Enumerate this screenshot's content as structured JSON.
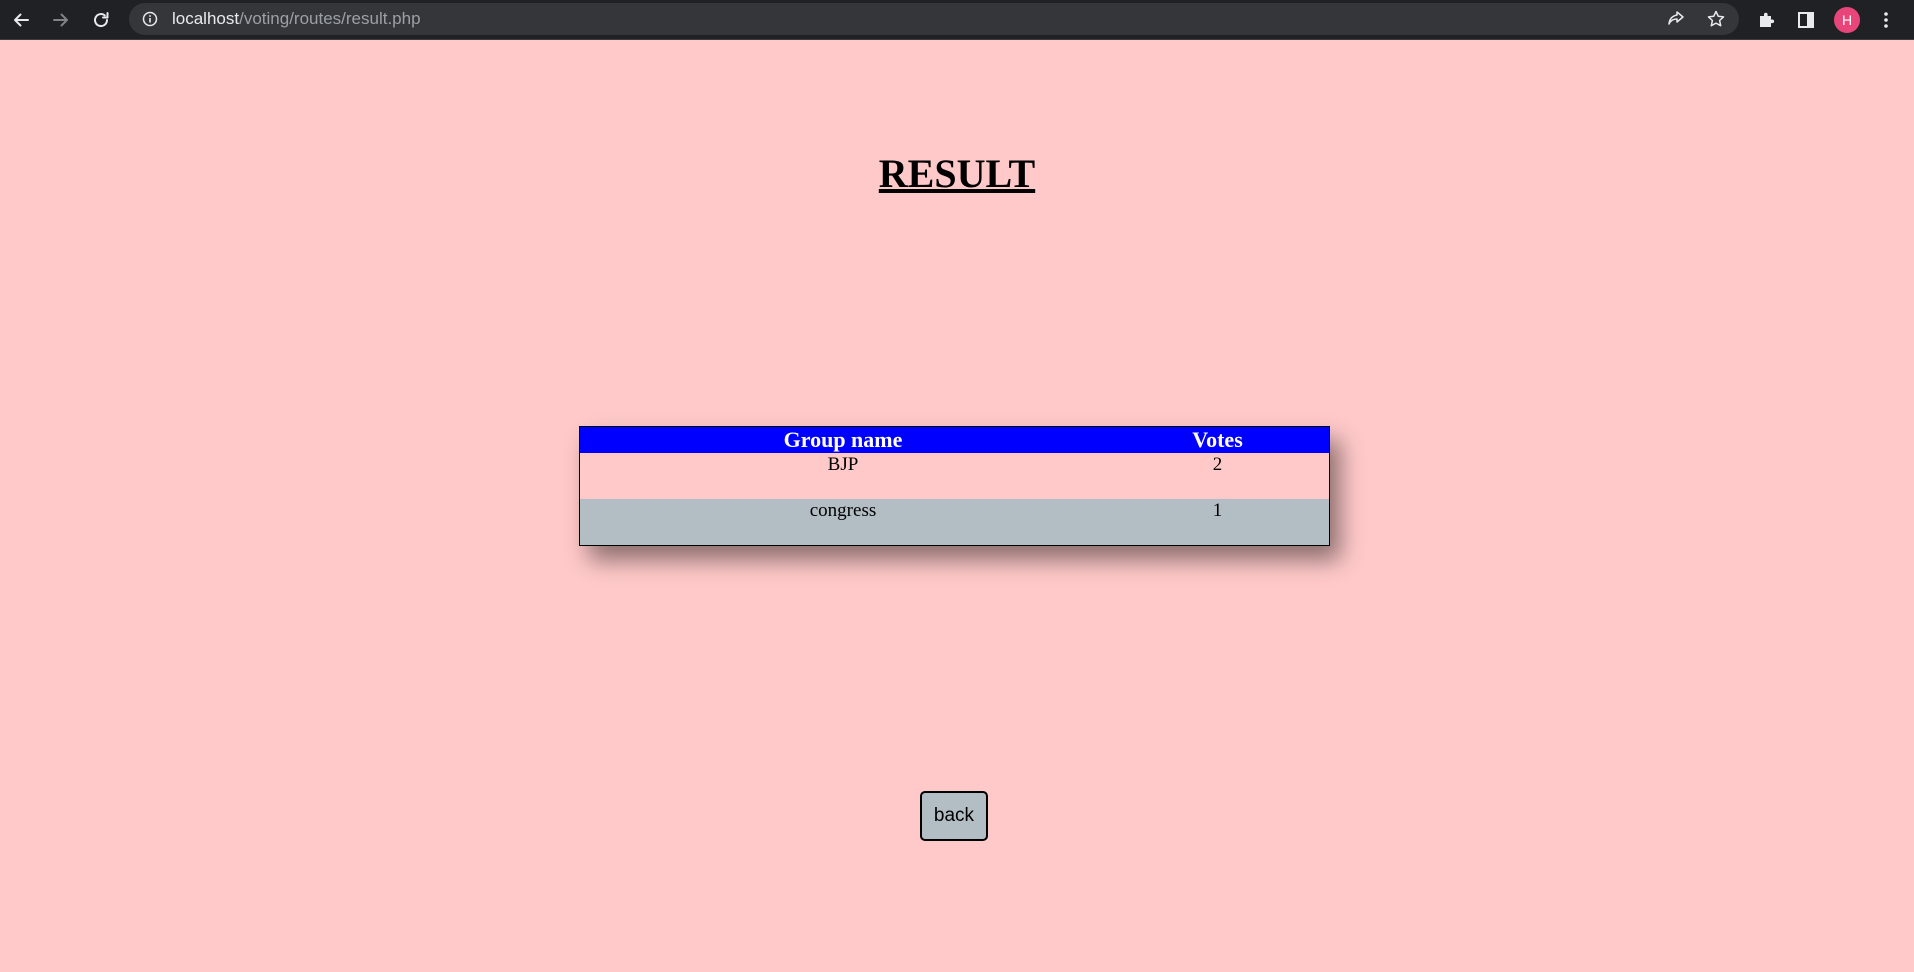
{
  "browser": {
    "url_host": "localhost",
    "url_path": "/voting/routes/result.php",
    "profile_initial": "H",
    "icons": {
      "back": "arrow-left-icon",
      "forward": "arrow-right-icon",
      "reload": "reload-icon",
      "site_info": "info-icon",
      "share": "share-icon",
      "bookmark": "star-icon",
      "extensions": "puzzle-icon",
      "side_panel": "side-panel-icon",
      "menu": "kebab-menu-icon"
    }
  },
  "page": {
    "title": "RESULT",
    "background": "#ffc9c9"
  },
  "results": {
    "headers": [
      "Group name",
      "Votes"
    ],
    "header_color": "#0000ff",
    "rows": [
      {
        "group": "BJP",
        "votes": "2"
      },
      {
        "group": "congress",
        "votes": "1"
      }
    ]
  },
  "actions": {
    "back_label": "back"
  }
}
